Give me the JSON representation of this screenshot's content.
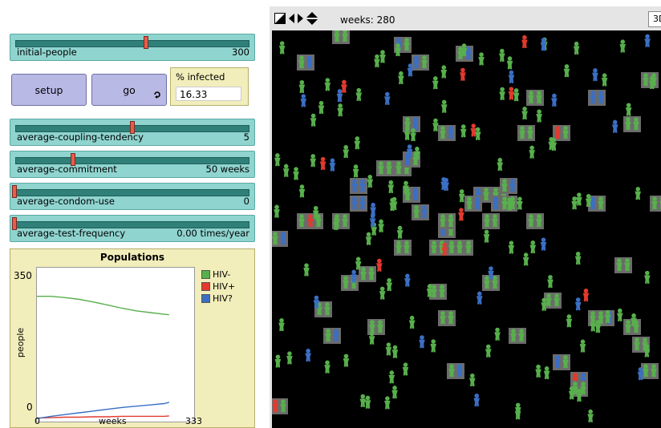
{
  "sliders": [
    {
      "label": "initial-people",
      "value": "300",
      "fraction": 0.57
    },
    {
      "label": "average-coupling-tendency",
      "value": "5",
      "fraction": 0.5
    },
    {
      "label": "average-commitment",
      "value": "50 weeks",
      "fraction": 0.25
    },
    {
      "label": "average-condom-use",
      "value": "0",
      "fraction": 0
    },
    {
      "label": "average-test-frequency",
      "value": "0.00 times/year",
      "fraction": 0
    }
  ],
  "buttons": {
    "setup": "setup",
    "go": "go"
  },
  "monitor": {
    "label": "% infected",
    "value": "16.33"
  },
  "plot": {
    "title": "Populations",
    "ylabel": "people",
    "xlabel": "weeks",
    "ymax_label": "350",
    "ymin_label": "0",
    "xmin_label": "0",
    "xmax_label": "333",
    "legend": [
      {
        "label": "HIV-",
        "color": "#58b04c"
      },
      {
        "label": "HIV+",
        "color": "#e23a2e"
      },
      {
        "label": "HIV?",
        "color": "#3b6fc4"
      }
    ]
  },
  "chart_data": {
    "type": "line",
    "xlabel": "weeks",
    "ylabel": "people",
    "xlim": [
      0,
      333
    ],
    "ylim": [
      0,
      350
    ],
    "series": [
      {
        "name": "HIV-",
        "x": [
          0,
          30,
          60,
          90,
          120,
          150,
          180,
          210,
          240,
          270,
          280
        ],
        "values": [
          285,
          285,
          282,
          278,
          272,
          265,
          258,
          252,
          248,
          244,
          243
        ]
      },
      {
        "name": "HIV+",
        "x": [
          0,
          30,
          60,
          90,
          120,
          150,
          180,
          210,
          240,
          270,
          280
        ],
        "values": [
          8,
          9,
          10,
          10,
          11,
          11,
          12,
          12,
          12,
          12,
          13
        ]
      },
      {
        "name": "HIV?",
        "x": [
          0,
          30,
          60,
          90,
          120,
          150,
          180,
          210,
          240,
          270,
          280
        ],
        "values": [
          7,
          12,
          16,
          20,
          24,
          28,
          32,
          35,
          38,
          41,
          44
        ]
      }
    ]
  },
  "world": {
    "ticks_label": "weeks: 280",
    "view_3d": "3D"
  },
  "colors": {
    "green": "#58b04c",
    "red": "#e23a2e",
    "blue": "#3b6fc4",
    "patch": "#6b6b6b"
  }
}
